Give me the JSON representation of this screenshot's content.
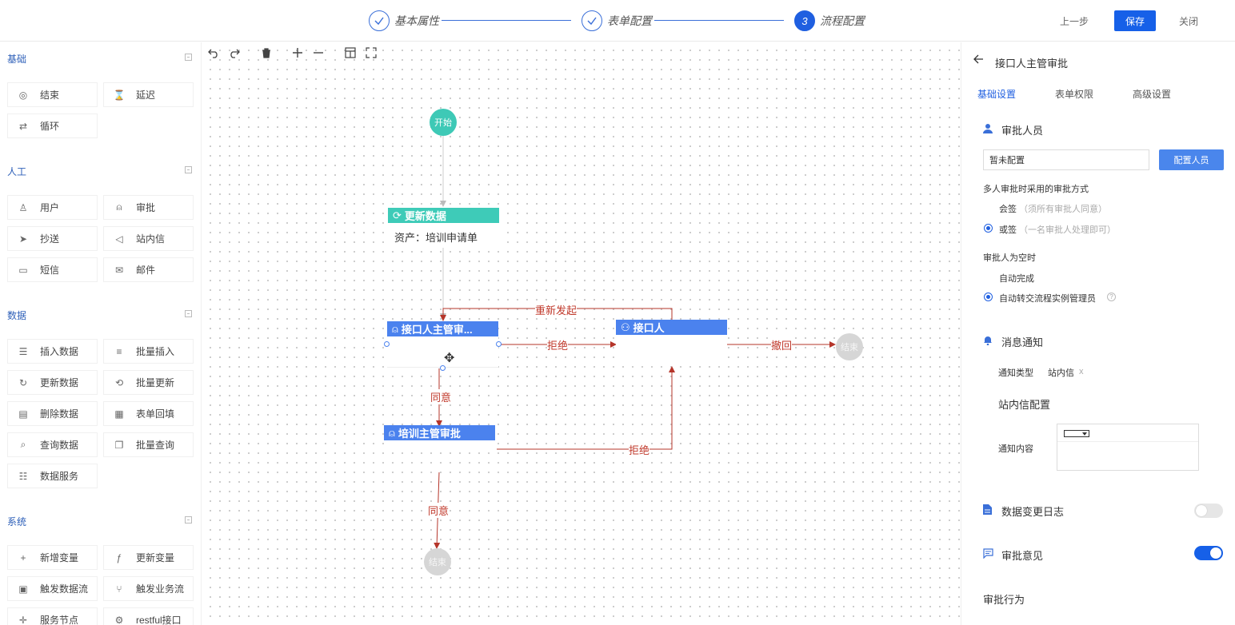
{
  "stepper": {
    "steps": [
      {
        "label": "基本属性",
        "state": "done"
      },
      {
        "label": "表单配置",
        "state": "done"
      },
      {
        "label": "流程配置",
        "state": "active",
        "number": "3"
      }
    ],
    "prev_label": "上一步",
    "save_label": "保存",
    "close_label": "关闭"
  },
  "palette": {
    "groups": [
      {
        "title": "基础",
        "items": [
          {
            "label": "结束",
            "icon": "end-circle-icon"
          },
          {
            "label": "延迟",
            "icon": "hourglass-icon"
          },
          {
            "label": "循环",
            "icon": "loop-icon"
          }
        ]
      },
      {
        "title": "人工",
        "items": [
          {
            "label": "用户",
            "icon": "user-icon"
          },
          {
            "label": "审批",
            "icon": "approve-stamp-icon"
          },
          {
            "label": "抄送",
            "icon": "cursor-icon"
          },
          {
            "label": "站内信",
            "icon": "speaker-icon"
          },
          {
            "label": "短信",
            "icon": "sms-icon"
          },
          {
            "label": "邮件",
            "icon": "mail-icon"
          }
        ]
      },
      {
        "title": "数据",
        "items": [
          {
            "label": "插入数据",
            "icon": "insert-icon"
          },
          {
            "label": "批量插入",
            "icon": "batch-insert-icon"
          },
          {
            "label": "更新数据",
            "icon": "refresh-icon"
          },
          {
            "label": "批量更新",
            "icon": "batch-refresh-icon"
          },
          {
            "label": "删除数据",
            "icon": "trash-icon"
          },
          {
            "label": "表单回填",
            "icon": "form-icon"
          },
          {
            "label": "查询数据",
            "icon": "search-icon"
          },
          {
            "label": "批量查询",
            "icon": "copy-icon"
          },
          {
            "label": "数据服务",
            "icon": "database-icon"
          }
        ]
      },
      {
        "title": "系统",
        "items": [
          {
            "label": "新增变量",
            "icon": "plus-icon"
          },
          {
            "label": "更新变量",
            "icon": "function-icon"
          },
          {
            "label": "触发数据流",
            "icon": "dataflow-icon"
          },
          {
            "label": "触发业务流",
            "icon": "bizflow-icon"
          },
          {
            "label": "服务节点",
            "icon": "service-icon"
          },
          {
            "label": "restful接口",
            "icon": "api-icon"
          }
        ]
      }
    ]
  },
  "toolbar": {
    "tools": [
      "undo-icon",
      "redo-icon",
      "delete-icon",
      "zoom-in-icon",
      "zoom-out-icon",
      "layout-icon",
      "fullscreen-icon"
    ]
  },
  "flow": {
    "start_label": "开始",
    "end_label": "结束",
    "update_node": {
      "title": "更新数据",
      "body": "资产：培训申请单"
    },
    "approve_node": {
      "title": "接口人主管审..."
    },
    "contact_node": {
      "title": "接口人"
    },
    "train_node": {
      "title": "培训主管审批"
    },
    "edges": {
      "resubmit": "重新发起",
      "reject1": "拒绝",
      "withdraw": "撤回",
      "agree1": "同意",
      "reject2": "拒绝",
      "agree2": "同意"
    },
    "colors": {
      "start": "#3ec9b6",
      "task": "#4b82ee",
      "edge_red": "#c0392b"
    }
  },
  "panel": {
    "title": "接口人主管审批",
    "tabs": [
      "基础设置",
      "表单权限",
      "高级设置"
    ],
    "approver_section": "审批人员",
    "approver_value": "暂未配置",
    "config_button": "配置人员",
    "multi_mode_label": "多人审批时采用的审批方式",
    "mode_options": [
      {
        "label": "会签",
        "hint": "（须所有审批人同意）",
        "checked": false
      },
      {
        "label": "或签",
        "hint": "（一名审批人处理即可）",
        "checked": true
      }
    ],
    "empty_label": "审批人为空时",
    "empty_options": [
      {
        "label": "自动完成",
        "checked": false
      },
      {
        "label": "自动转交流程实例管理员",
        "checked": true
      }
    ],
    "notify_section": "消息通知",
    "notify_type_label": "通知类型",
    "notify_type_value": "站内信",
    "notify_type_remove": "x",
    "inmail_config": "站内信配置",
    "notify_content_label": "通知内容",
    "log_section": "数据变更日志",
    "log_enabled": false,
    "opinion_section": "审批意见",
    "opinion_enabled": true,
    "behavior_section": "审批行为"
  }
}
